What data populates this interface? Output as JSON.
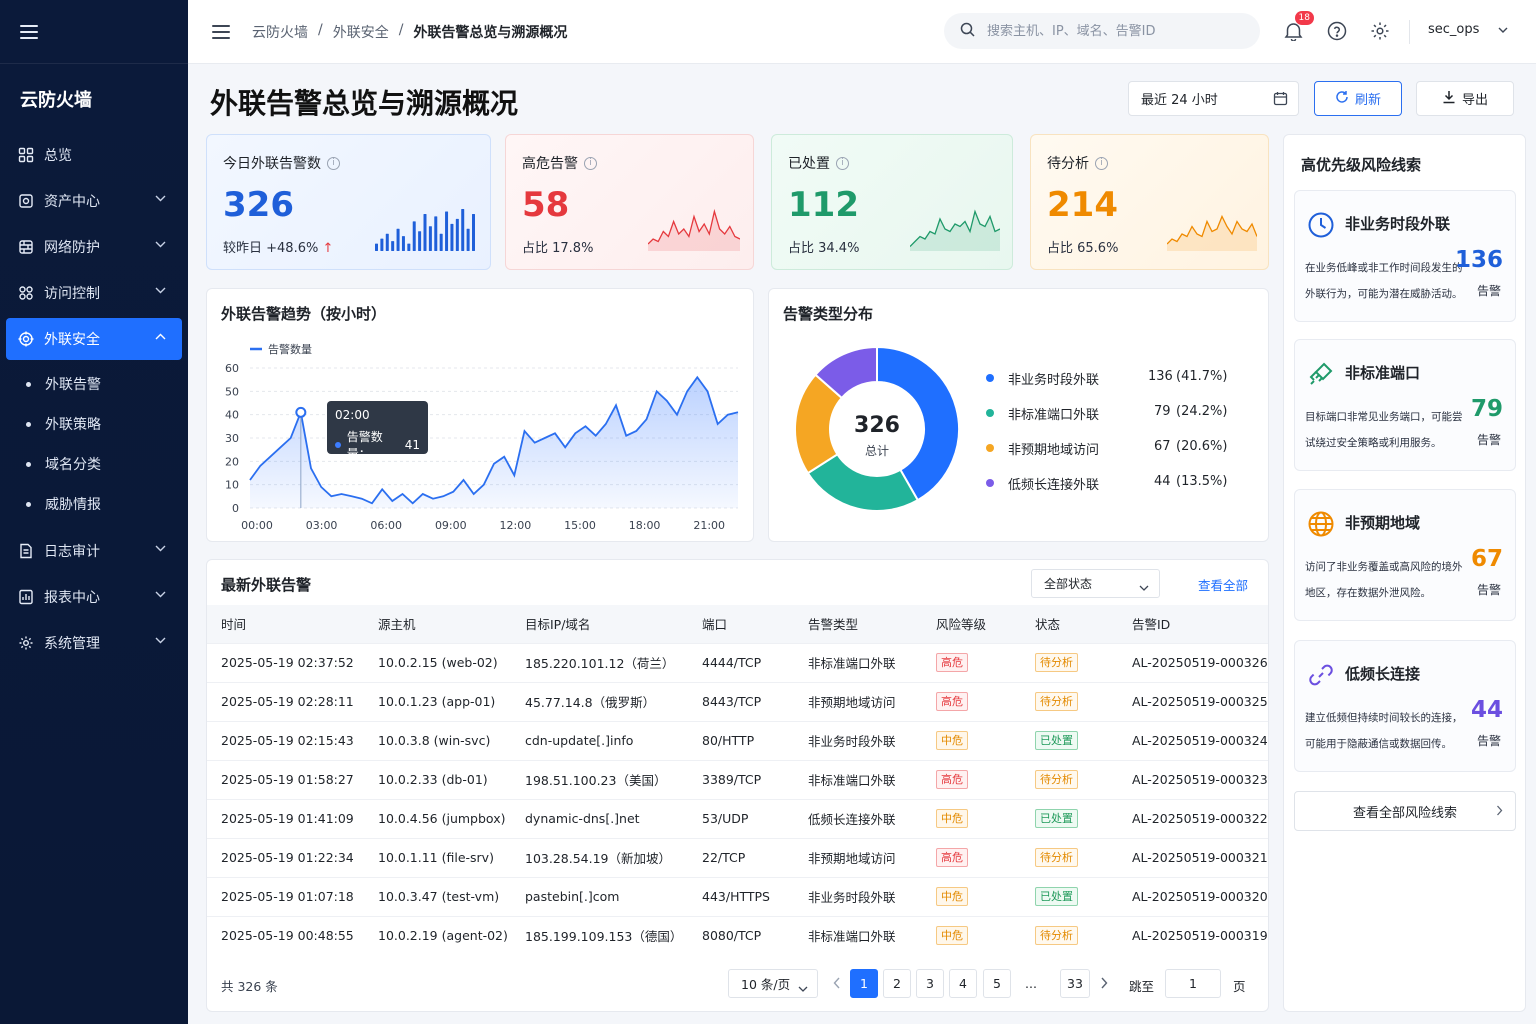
{
  "sidebar": {
    "brand": "云防火墙",
    "items": [
      {
        "label": "总览"
      },
      {
        "label": "资产中心"
      },
      {
        "label": "网络防护"
      },
      {
        "label": "访问控制"
      },
      {
        "label": "外联安全"
      },
      {
        "label": "日志审计"
      },
      {
        "label": "报表中心"
      },
      {
        "label": "系统管理"
      }
    ],
    "sub_items": [
      {
        "label": "外联告警"
      },
      {
        "label": "外联策略"
      },
      {
        "label": "域名分类"
      },
      {
        "label": "威胁情报"
      }
    ]
  },
  "header": {
    "breadcrumb": [
      "云防火墙",
      "/",
      "外联安全",
      "/",
      "外联告警总览与溯源概况"
    ],
    "search_placeholder": "搜索主机、IP、域名、告警ID",
    "notification_count": "18",
    "user": "sec_ops"
  },
  "page": {
    "title": "外联告警总览与溯源概况",
    "time_range": "最近 24 小时",
    "refresh_label": "刷新",
    "export_label": "导出"
  },
  "kpis": [
    {
      "title": "今日外联告警数",
      "value": "326",
      "sub": "较昨日 +48.6%",
      "trend_arrow": "↑",
      "color": "#1f5fd9"
    },
    {
      "title": "高危告警",
      "value": "58",
      "sub": "占比 17.8%",
      "color": "#e5393e"
    },
    {
      "title": "已处置",
      "value": "112",
      "sub": "占比 34.4%",
      "color": "#1f9a6a"
    },
    {
      "title": "待分析",
      "value": "214",
      "sub": "占比 65.6%",
      "color": "#ef8a00"
    }
  ],
  "trend": {
    "title": "外联告警趋势（按小时）",
    "tooltip_time": "02:00",
    "tooltip_label": "告警数量：",
    "tooltip_value": "41"
  },
  "chart_data": [
    {
      "type": "area",
      "title": "外联告警趋势（按小时）",
      "series": [
        {
          "name": "告警数量",
          "values": [
            12,
            18,
            22,
            26,
            30,
            41,
            17,
            9,
            5,
            6,
            5,
            4,
            2,
            8,
            3,
            6,
            2,
            6,
            4,
            5,
            7,
            12,
            6,
            10,
            19,
            22,
            14,
            33,
            28,
            30,
            32,
            26,
            32,
            35,
            31,
            36,
            44,
            31,
            33,
            38,
            50,
            46,
            40,
            50,
            56,
            50,
            36,
            40,
            41
          ]
        }
      ],
      "x_ticks": [
        "00:00",
        "03:00",
        "06:00",
        "09:00",
        "12:00",
        "15:00",
        "18:00",
        "21:00"
      ],
      "ylim": [
        0,
        60
      ],
      "y_ticks": [
        "0",
        "10",
        "20",
        "30",
        "40",
        "50",
        "60"
      ],
      "xlabel": "",
      "ylabel": "",
      "legend": "top-left"
    },
    {
      "type": "pie",
      "title": "告警类型分布",
      "center_value": "326",
      "center_label": "总计",
      "slices": [
        {
          "name": "非业务时段外联",
          "value": 136,
          "pct": "(41.7%)",
          "color": "#1f6fff"
        },
        {
          "name": "非标准端口外联",
          "value": 79,
          "pct": "(24.2%)",
          "color": "#22b49a"
        },
        {
          "name": "非预期地域访问",
          "value": 67,
          "pct": "(20.6%)",
          "color": "#f5a623"
        },
        {
          "name": "低频长连接外联",
          "value": 44,
          "pct": "(13.5%)",
          "color": "#7b5ce8"
        }
      ]
    }
  ],
  "alerts": {
    "title": "最新外联告警",
    "status_filter": "全部状态",
    "view_all": "查看全部",
    "columns": [
      "时间",
      "源主机",
      "目标IP/域名",
      "端口",
      "告警类型",
      "风险等级",
      "状态",
      "告警ID"
    ],
    "rows": [
      [
        "2025-05-19 02:37:52",
        "10.0.2.15 (web-02)",
        "185.220.101.12（荷兰）",
        "4444/TCP",
        "非标准端口外联",
        "高危",
        "待分析",
        "AL-20250519-000326"
      ],
      [
        "2025-05-19 02:28:11",
        "10.0.1.23 (app-01)",
        "45.77.14.8（俄罗斯）",
        "8443/TCP",
        "非预期地域访问",
        "高危",
        "待分析",
        "AL-20250519-000325"
      ],
      [
        "2025-05-19 02:15:43",
        "10.0.3.8 (win-svc)",
        "cdn-update[.]info",
        "80/HTTP",
        "非业务时段外联",
        "中危",
        "已处置",
        "AL-20250519-000324"
      ],
      [
        "2025-05-19 01:58:27",
        "10.0.2.33 (db-01)",
        "198.51.100.23（美国）",
        "3389/TCP",
        "非标准端口外联",
        "高危",
        "待分析",
        "AL-20250519-000323"
      ],
      [
        "2025-05-19 01:41:09",
        "10.0.4.56 (jumpbox)",
        "dynamic-dns[.]net",
        "53/UDP",
        "低频长连接外联",
        "中危",
        "已处置",
        "AL-20250519-000322"
      ],
      [
        "2025-05-19 01:22:34",
        "10.0.1.11 (file-srv)",
        "103.28.54.19（新加坡）",
        "22/TCP",
        "非预期地域访问",
        "高危",
        "待分析",
        "AL-20250519-000321"
      ],
      [
        "2025-05-19 01:07:18",
        "10.0.3.47 (test-vm)",
        "pastebin[.]com",
        "443/HTTPS",
        "非业务时段外联",
        "中危",
        "已处置",
        "AL-20250519-000320"
      ],
      [
        "2025-05-19 00:48:55",
        "10.0.2.19 (agent-02)",
        "185.199.109.153（德国）",
        "8080/TCP",
        "非标准端口外联",
        "中危",
        "待分析",
        "AL-20250519-000319"
      ]
    ],
    "total": "共  326  条",
    "page_size": "10 条/页",
    "pages": [
      "1",
      "2",
      "3",
      "4",
      "5",
      "...",
      "33"
    ],
    "jump_label": "跳至",
    "jump_value": "1",
    "page_unit": "页"
  },
  "clues": {
    "title": "高优先级风险线索",
    "items": [
      {
        "title": "非业务时段外联",
        "desc": "在业务低峰或非工作时间段发生的外联行为，可能为潜在威胁活动。",
        "count": "136",
        "unit": "告警",
        "color": "#1f5fd9",
        "icon": "clock-icon"
      },
      {
        "title": "非标准端口",
        "desc": "目标端口非常见业务端口，可能尝试绕过安全策略或利用服务。",
        "count": "79",
        "unit": "告警",
        "color": "#1f9a6a",
        "icon": "plug-icon"
      },
      {
        "title": "非预期地域",
        "desc": "访问了非业务覆盖或高风险的境外地区，存在数据外泄风险。",
        "count": "67",
        "unit": "告警",
        "color": "#ef8a00",
        "icon": "globe-icon"
      },
      {
        "title": "低频长连接",
        "desc": "建立低频但持续时间较长的连接，可能用于隐蔽通信或数据回传。",
        "count": "44",
        "unit": "告警",
        "color": "#6b4fe0",
        "icon": "link-icon"
      }
    ],
    "view_all": "查看全部风险线索"
  }
}
